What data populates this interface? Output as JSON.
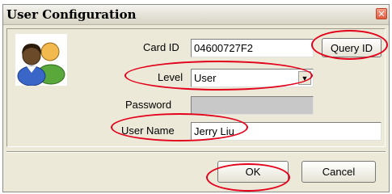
{
  "window": {
    "title": "User Configuration"
  },
  "form": {
    "card_id_label": "Card ID",
    "card_id_value": "04600727F2",
    "query_button": "Query ID",
    "level_label": "Level",
    "level_value": "User",
    "password_label": "Password",
    "password_value": "",
    "user_name_label": "User Name",
    "user_name_value": "Jerry Liu"
  },
  "footer": {
    "ok_label": "OK",
    "cancel_label": "Cancel"
  },
  "icons": {
    "close": "close-icon",
    "avatar": "users-icon",
    "dropdown": "chevron-down-icon"
  },
  "colors": {
    "annotation": "#e3001b",
    "title_bg": "#ece9d8",
    "close": "#e05a3c"
  }
}
